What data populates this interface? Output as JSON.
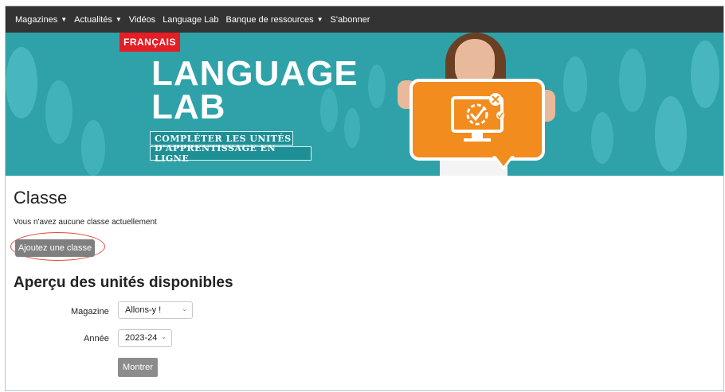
{
  "nav": {
    "items": [
      {
        "label": "Magazines",
        "has_dropdown": true
      },
      {
        "label": "Actualités",
        "has_dropdown": true
      },
      {
        "label": "Vidéos",
        "has_dropdown": false
      },
      {
        "label": "Language Lab",
        "has_dropdown": false
      },
      {
        "label": "Banque de ressources",
        "has_dropdown": true
      },
      {
        "label": "S'abonner",
        "has_dropdown": false
      }
    ]
  },
  "banner": {
    "badge": "FRANÇAIS",
    "title_line1": "LANGUAGE",
    "title_line2": "LAB",
    "subtitle_line1": "COMPLÉTER LES UNITÉS",
    "subtitle_line2": "D'APPRENTISSAGE EN LIGNE"
  },
  "classe": {
    "heading": "Classe",
    "empty_text": "Vous n'avez aucune classe actuellement",
    "add_button": "Ajoutez une classe"
  },
  "apercu": {
    "heading": "Aperçu des unités disponibles",
    "magazine_label": "Magazine",
    "magazine_value": "Allons-y !",
    "annee_label": "Année",
    "annee_value": "2023-24",
    "show_button": "Montrer"
  },
  "colors": {
    "nav_bg": "#333333",
    "banner_bg": "#2ea2a8",
    "badge_red": "#e31e24",
    "sign_orange": "#f28c1e",
    "button_gray": "#7f7f7f",
    "highlight_ring": "#e04a35"
  },
  "icons": {
    "dropdown": "caret-down-icon",
    "sign_graphic": "computer-checkmark-gear-icon"
  }
}
